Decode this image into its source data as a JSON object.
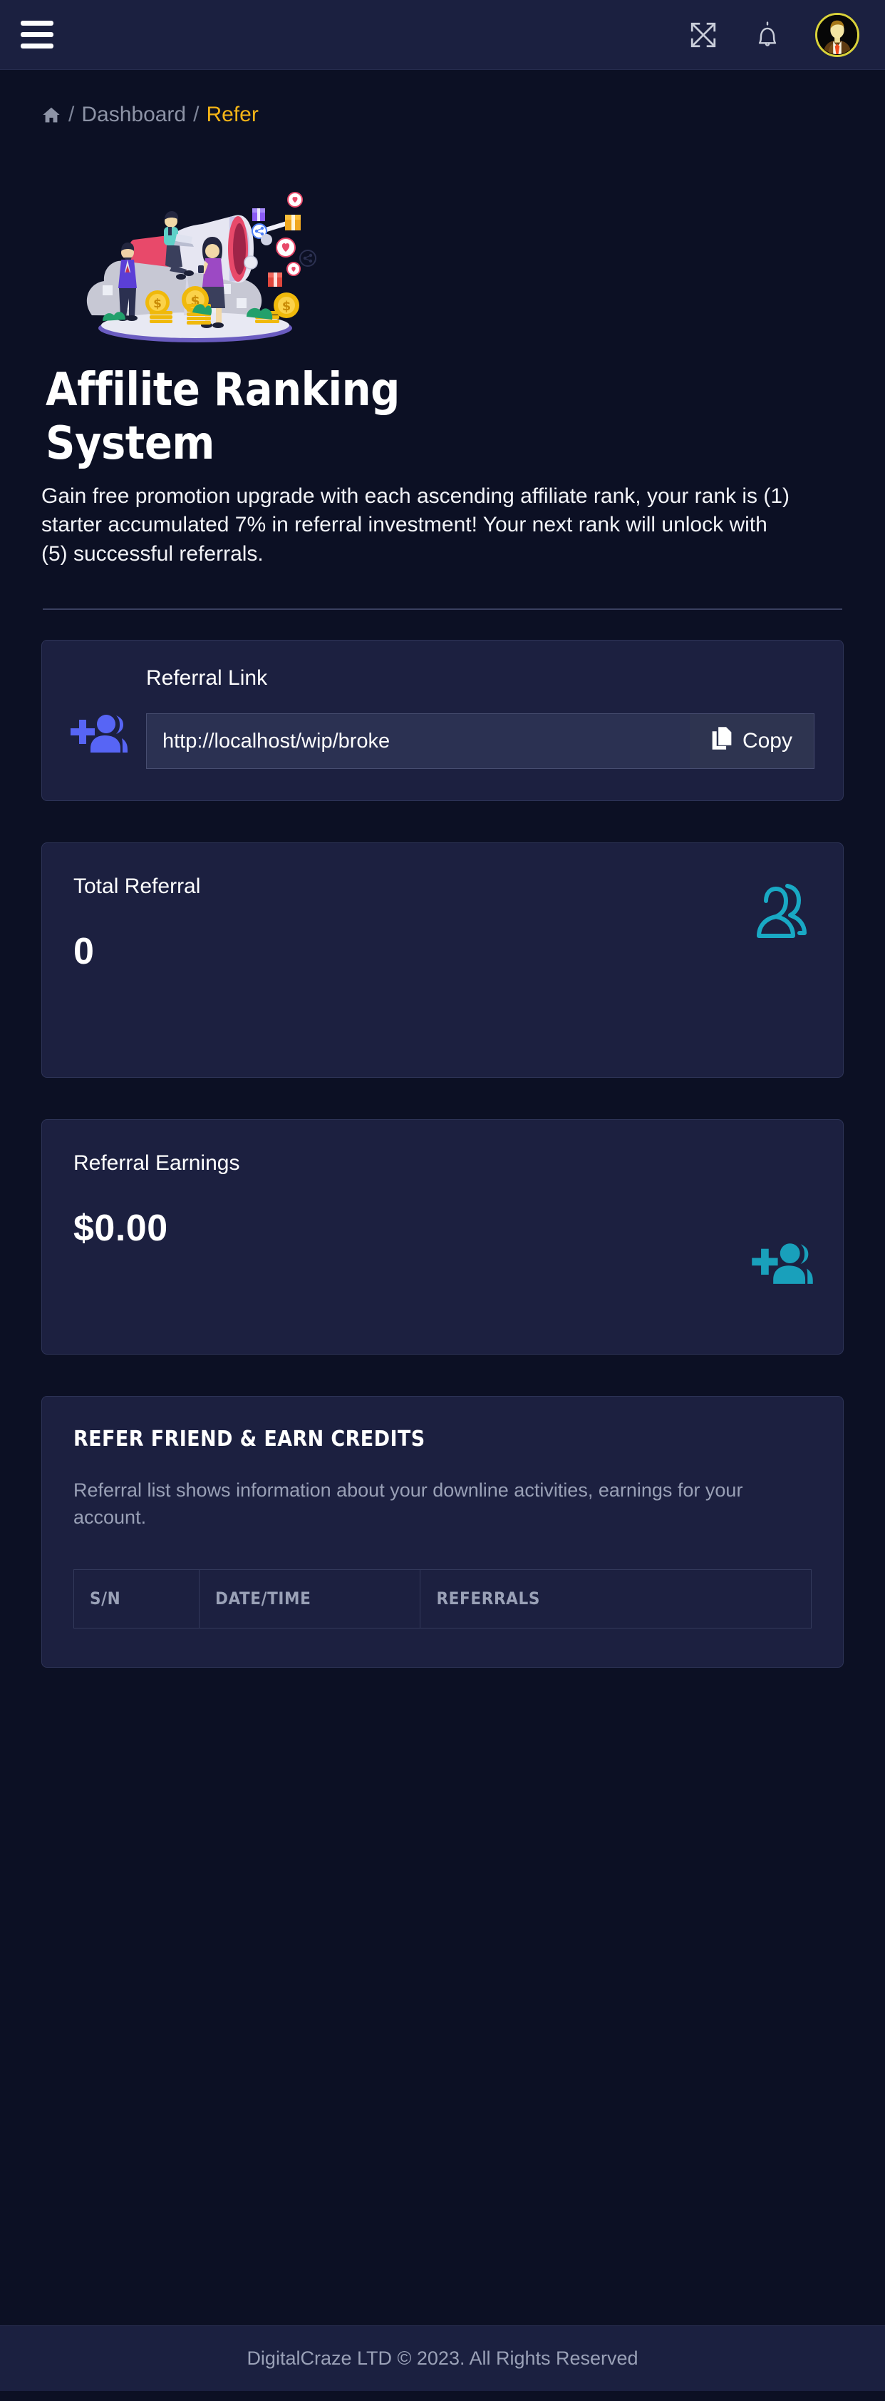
{
  "topbar": {
    "menu_icon": "hamburger-menu-icon",
    "fullscreen_icon": "fullscreen-expand-icon",
    "notification_icon": "bell-icon",
    "avatar_alt": "user-avatar"
  },
  "breadcrumb": {
    "home_icon": "home-icon",
    "separator": "/",
    "items": [
      {
        "label": "Dashboard",
        "active": false
      },
      {
        "label": "Refer",
        "active": true
      }
    ]
  },
  "hero": {
    "image_alt": "affiliate-megaphone-illustration",
    "title": "Affilite Ranking System",
    "description": "Gain free promotion upgrade with each ascending affiliate rank, your rank is (1) starter accumulated 7% in referral investment! Your next rank will unlock with (5) successful referrals."
  },
  "referral_link_card": {
    "icon": "add-users-icon",
    "label": "Referral Link",
    "input_value": "http://localhost/wip/broke",
    "input_placeholder": "Referral link",
    "copy_button_label": "Copy",
    "copy_icon": "copy-icon"
  },
  "stats": [
    {
      "label": "Total Referral",
      "value": "0",
      "icon": "users-outline-icon",
      "icon_color": "#19a9c4"
    },
    {
      "label": "Referral Earnings",
      "value": "$0.00",
      "icon": "add-users-icon",
      "icon_color": "#19a0bb"
    }
  ],
  "refer_section": {
    "title": "REFER FRIEND & EARN CREDITS",
    "description": "Referral list shows information about your downline activities, earnings for your account.",
    "table": {
      "headers": [
        "S/N",
        "DATE/TIME",
        "REFERRALS"
      ],
      "rows": []
    }
  },
  "footer": {
    "text": "DigitalCraze LTD © 2023. All Rights Reserved"
  },
  "colors": {
    "page_bg": "#0c1024",
    "panel_bg": "#1b2040",
    "card_bg": "#1c2040",
    "card_border": "#2e3457",
    "accent_yellow": "#f5b417",
    "accent_blue": "#5765f5",
    "accent_cyan": "#19a9c4",
    "muted_text": "#99a0b6"
  }
}
